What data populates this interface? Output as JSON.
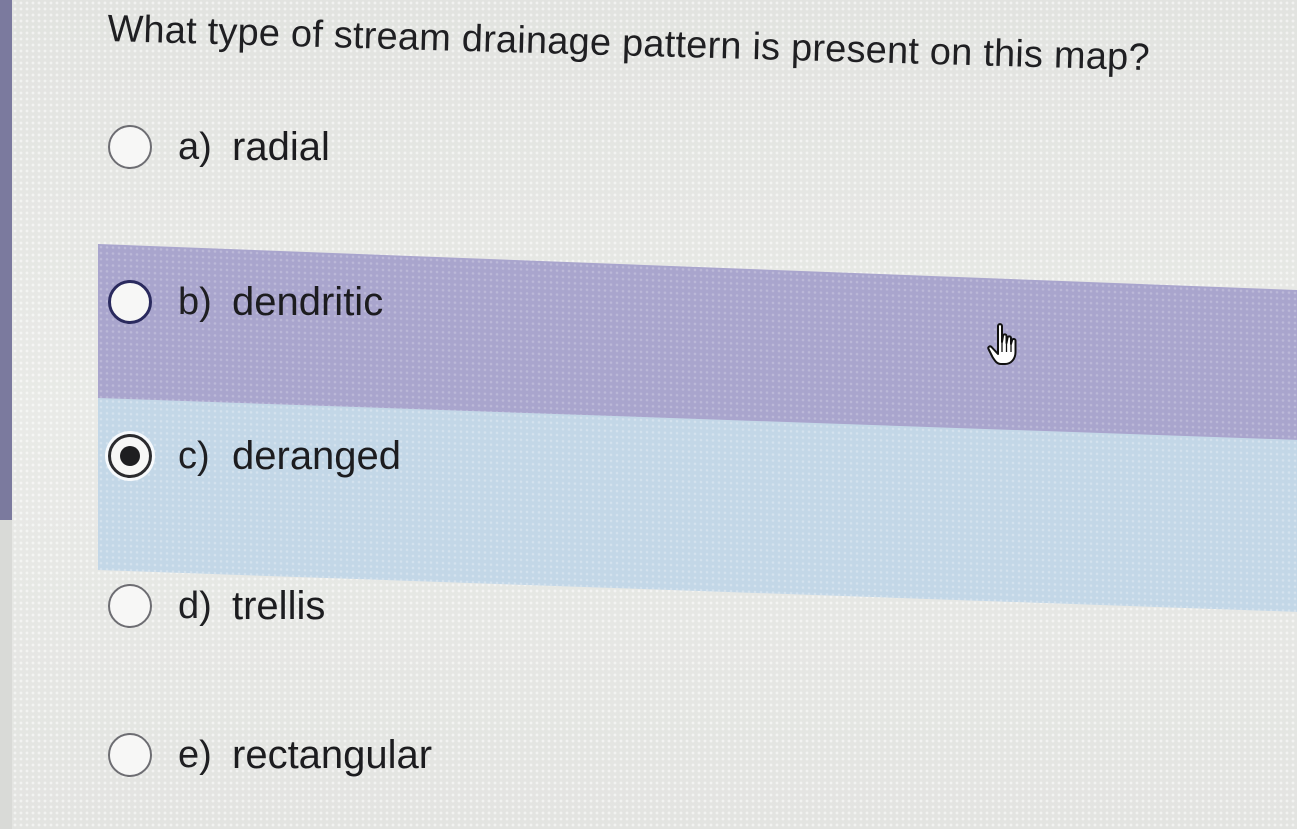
{
  "question": {
    "text": "What type of stream drainage pattern is present on this map?"
  },
  "options": [
    {
      "letter": "a)",
      "label": "radial",
      "selected": false,
      "hovered": false
    },
    {
      "letter": "b)",
      "label": "dendritic",
      "selected": false,
      "hovered": true
    },
    {
      "letter": "c)",
      "label": "deranged",
      "selected": true,
      "hovered": false
    },
    {
      "letter": "d)",
      "label": "trellis",
      "selected": false,
      "hovered": false
    },
    {
      "letter": "e)",
      "label": "rectangular",
      "selected": false,
      "hovered": false
    }
  ],
  "colors": {
    "hover_band": "#a9a5cd",
    "selected_band": "#c3d7e7",
    "text": "#1f1f22"
  },
  "icons": {
    "cursor": "hand-pointer-icon"
  }
}
